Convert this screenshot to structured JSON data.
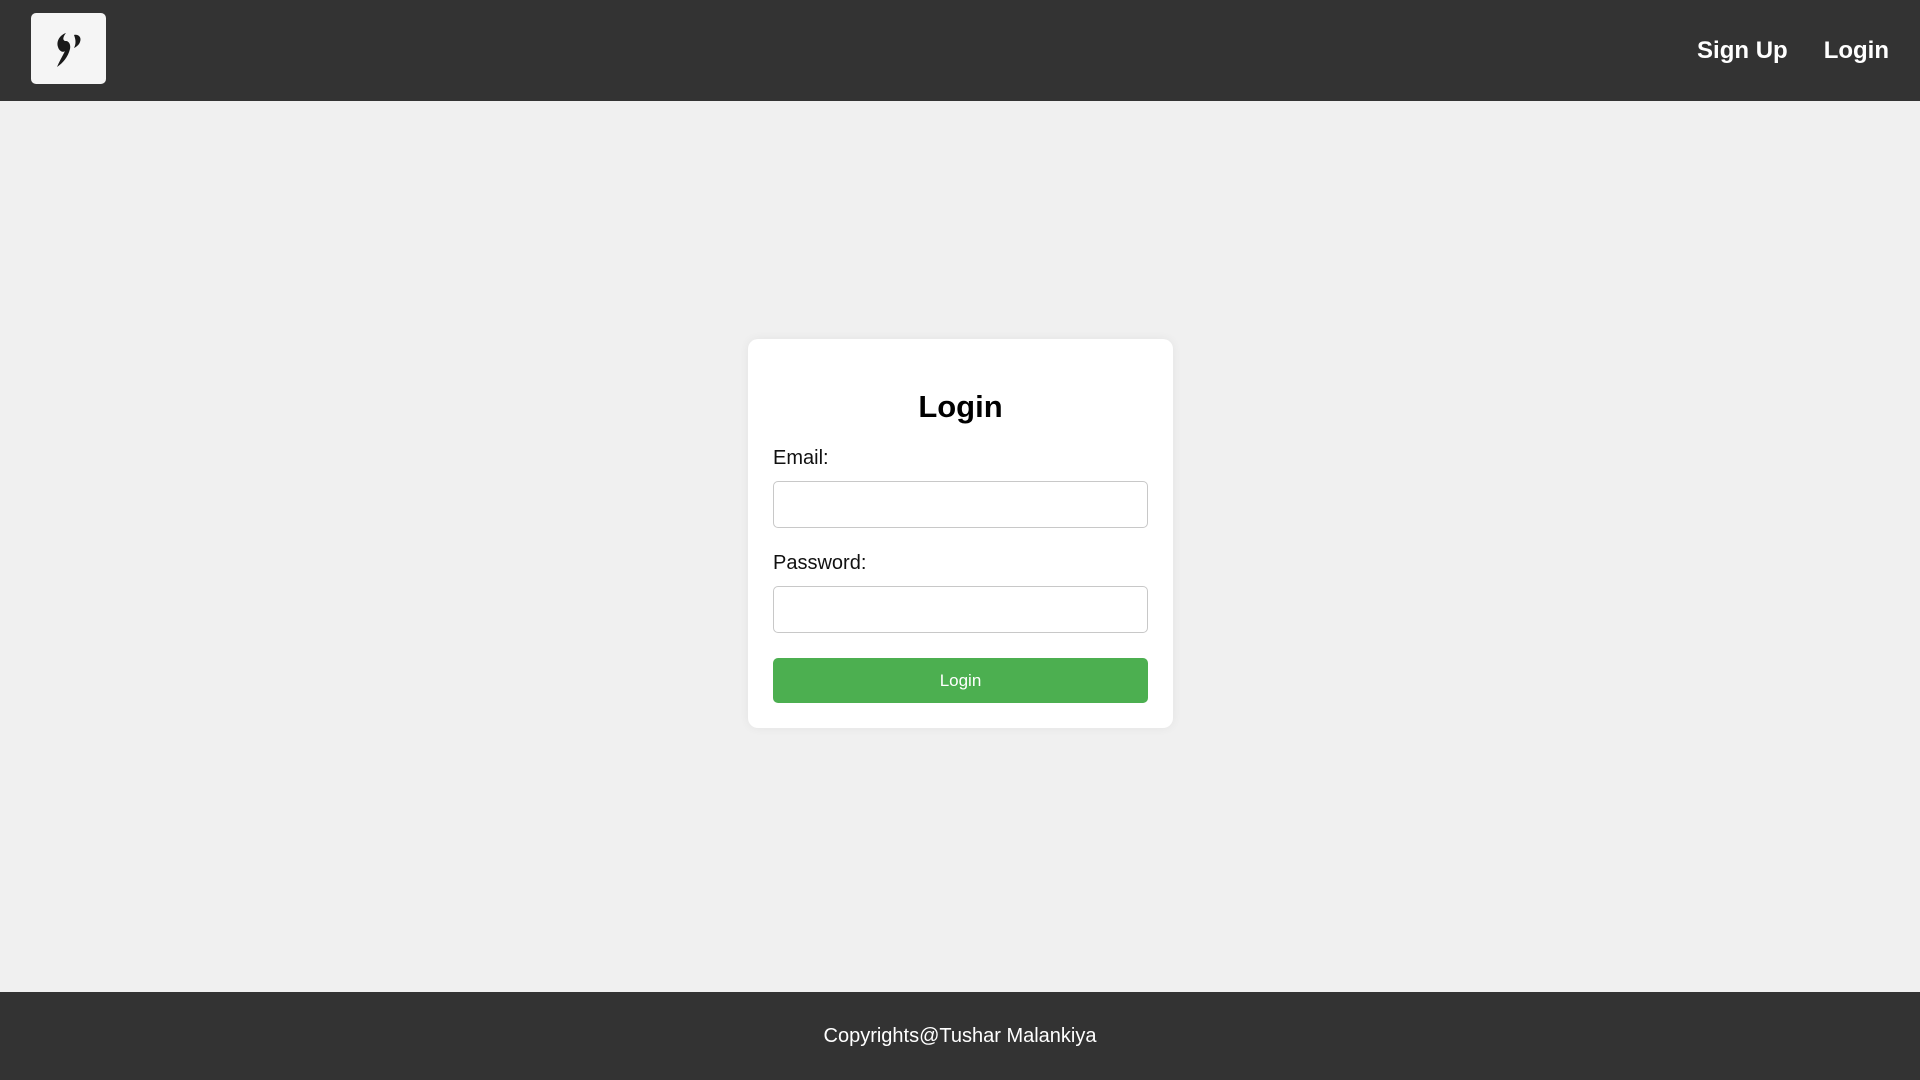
{
  "header": {
    "logo_icon": "flame-icon",
    "nav": {
      "signup_label": "Sign Up",
      "login_label": "Login"
    }
  },
  "login_form": {
    "title": "Login",
    "email_label": "Email:",
    "email_value": "",
    "password_label": "Password:",
    "password_value": "",
    "submit_label": "Login"
  },
  "footer": {
    "copyright": "Copyrights@Tushar Malankiya"
  },
  "colors": {
    "navbar": "#333333",
    "background": "#f0f0f0",
    "button": "#4caf50"
  }
}
